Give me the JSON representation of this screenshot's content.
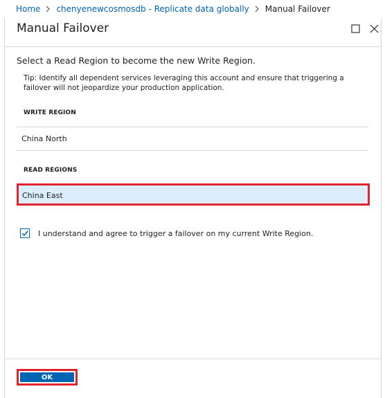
{
  "breadcrumb": {
    "home": "Home",
    "parent": "chenyenewcosmosdb - Replicate data globally",
    "current": "Manual Failover"
  },
  "blade": {
    "title": "Manual Failover",
    "maximize_icon": "maximize-icon",
    "close_icon": "close-icon"
  },
  "intro": "Select a Read Region to become the new Write Region.",
  "tip": "Tip: Identify all dependent services leveraging this account and ensure that triggering a failover will not jeopardize your production application.",
  "write_region": {
    "label": "WRITE REGION",
    "value": "China North"
  },
  "read_regions": {
    "label": "READ REGIONS",
    "items": [
      {
        "label": "China East",
        "selected": true
      }
    ]
  },
  "agree": {
    "checked": true,
    "label": "I understand and agree to trigger a failover on my current Write Region."
  },
  "footer": {
    "ok_label": "OK"
  },
  "colors": {
    "accent": "#0065b3",
    "highlight_border": "#e0242f",
    "selected_row": "#dcedfb"
  }
}
